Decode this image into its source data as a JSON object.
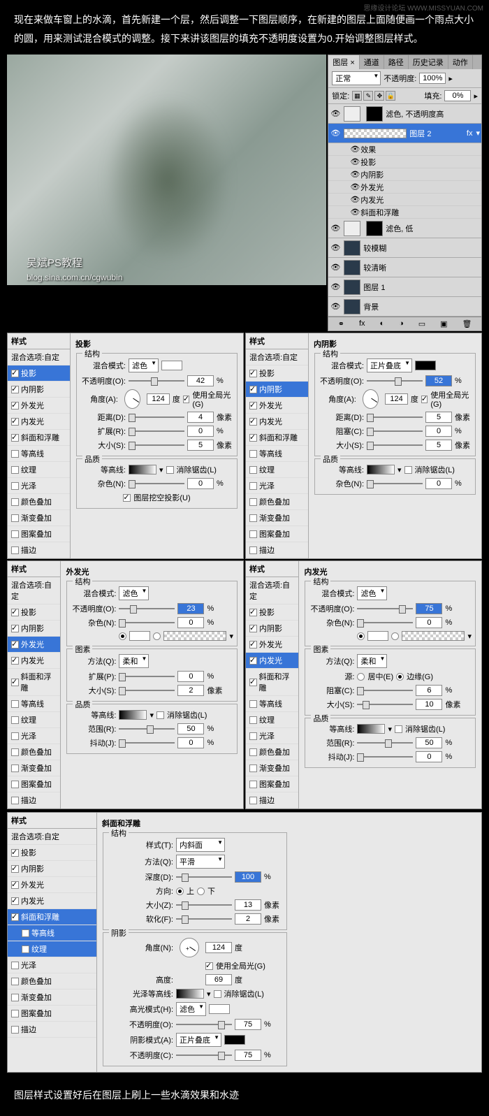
{
  "watermark_tr": "思缘设计论坛 WWW.MISSYUAN.COM",
  "intro": "现在来做车窗上的水滴，首先新建一个层，然后调整一下图层顺序，在新建的图层上面随便画一个雨点大小的圆，用来测试混合模式的调整。接下来讲该图层的填充不透明度设置为0.开始调整图层样式。",
  "outro": "图层样式设置好后在图层上刷上一些水滴效果和水迹",
  "preview": {
    "wm1": "吴斌PS教程",
    "wm2": "blog.sina.com.cn/cgwubin"
  },
  "layers": {
    "tabs": [
      "图层 ×",
      "通道",
      "路径",
      "历史记录",
      "动作"
    ],
    "blend": "正常",
    "opacity_label": "不透明度:",
    "opacity": "100%",
    "lock": "锁定:",
    "fill_label": "填充:",
    "fill": "0%",
    "items": [
      {
        "name": "滤色, 不透明度高",
        "type": "text"
      },
      {
        "name": "图层 2",
        "type": "checker",
        "sel": true,
        "fx": "fx"
      },
      {
        "name": "效果",
        "type": "sub"
      },
      {
        "name": "投影",
        "type": "sub"
      },
      {
        "name": "内阴影",
        "type": "sub"
      },
      {
        "name": "外发光",
        "type": "sub"
      },
      {
        "name": "内发光",
        "type": "sub"
      },
      {
        "name": "斜面和浮雕",
        "type": "sub"
      },
      {
        "name": "滤色, 低",
        "type": "mask"
      },
      {
        "name": "较模糊",
        "type": "dark"
      },
      {
        "name": "较清晰",
        "type": "dark"
      },
      {
        "name": "图层 1",
        "type": "dark"
      },
      {
        "name": "背景",
        "type": "dark"
      }
    ]
  },
  "styles_header": "样式",
  "blend_opts": "混合选项:自定",
  "style_list": [
    "投影",
    "内阴影",
    "外发光",
    "内发光",
    "斜面和浮雕",
    "等高线",
    "纹理",
    "光泽",
    "颜色叠加",
    "渐变叠加",
    "图案叠加",
    "描边"
  ],
  "p1": {
    "title": "投影",
    "struct": "结构",
    "blend": "混合模式:",
    "blend_v": "滤色",
    "op": "不透明度(O):",
    "op_v": "42",
    "ang": "角度(A):",
    "ang_v": "124",
    "deg": "度",
    "glob": "使用全局光(G)",
    "dist": "距离(D):",
    "dist_v": "4",
    "px": "像素",
    "spread": "扩展(R):",
    "spread_v": "0",
    "pct": "%",
    "size": "大小(S):",
    "size_v": "5",
    "qual": "品质",
    "contour": "等高线:",
    "anti": "消除锯齿(L)",
    "noise": "杂色(N):",
    "noise_v": "0",
    "knock": "图层挖空投影(U)"
  },
  "p2": {
    "title": "内阴影",
    "struct": "结构",
    "blend": "混合模式:",
    "blend_v": "正片叠底",
    "op": "不透明度(O):",
    "op_v": "52",
    "ang": "角度(A):",
    "ang_v": "124",
    "deg": "度",
    "glob": "使用全局光(G)",
    "dist": "距离(D):",
    "dist_v": "5",
    "px": "像素",
    "choke": "阻塞(C):",
    "choke_v": "0",
    "pct": "%",
    "size": "大小(S):",
    "size_v": "5",
    "qual": "品质",
    "contour": "等高线:",
    "anti": "消除锯齿(L)",
    "noise": "杂色(N):",
    "noise_v": "0"
  },
  "p3": {
    "title": "外发光",
    "struct": "结构",
    "blend": "混合模式:",
    "blend_v": "滤色",
    "op": "不透明度(O):",
    "op_v": "23",
    "noise": "杂色(N):",
    "noise_v": "0",
    "pct": "%",
    "elem": "图素",
    "tech": "方法(Q):",
    "tech_v": "柔和",
    "spread": "扩展(P):",
    "spread_v": "0",
    "size": "大小(S):",
    "size_v": "2",
    "px": "像素",
    "qual": "品质",
    "contour": "等高线:",
    "anti": "消除锯齿(L)",
    "range": "范围(R):",
    "range_v": "50",
    "jitter": "抖动(J):",
    "jitter_v": "0"
  },
  "p4": {
    "title": "内发光",
    "struct": "结构",
    "blend": "混合模式:",
    "blend_v": "滤色",
    "op": "不透明度(O):",
    "op_v": "75",
    "noise": "杂色(N):",
    "noise_v": "0",
    "pct": "%",
    "elem": "图素",
    "tech": "方法(Q):",
    "tech_v": "柔和",
    "src": "源:",
    "center": "居中(E)",
    "edge": "边缘(G)",
    "choke": "阻塞(C):",
    "choke_v": "6",
    "size": "大小(S):",
    "size_v": "10",
    "px": "像素",
    "qual": "品质",
    "contour": "等高线:",
    "anti": "消除锯齿(L)",
    "range": "范围(R):",
    "range_v": "50",
    "jitter": "抖动(J):",
    "jitter_v": "0"
  },
  "p5": {
    "title": "斜面和浮雕",
    "struct": "结构",
    "style": "样式(T):",
    "style_v": "内斜面",
    "tech": "方法(Q):",
    "tech_v": "平滑",
    "depth": "深度(D):",
    "depth_v": "100",
    "pct": "%",
    "dir": "方向:",
    "up": "上",
    "down": "下",
    "size": "大小(Z):",
    "size_v": "13",
    "px": "像素",
    "soft": "软化(F):",
    "soft_v": "2",
    "shade": "阴影",
    "ang": "角度(N):",
    "ang_v": "124",
    "deg": "度",
    "glob": "使用全局光(G)",
    "alt": "高度:",
    "alt_v": "69",
    "gloss": "光泽等高线:",
    "anti": "消除锯齿(L)",
    "hi": "高光模式(H):",
    "hi_v": "滤色",
    "hi_op": "不透明度(O):",
    "hi_opv": "75",
    "sh": "阴影模式(A):",
    "sh_v": "正片叠底",
    "sh_op": "不透明度(C):",
    "sh_opv": "75"
  }
}
